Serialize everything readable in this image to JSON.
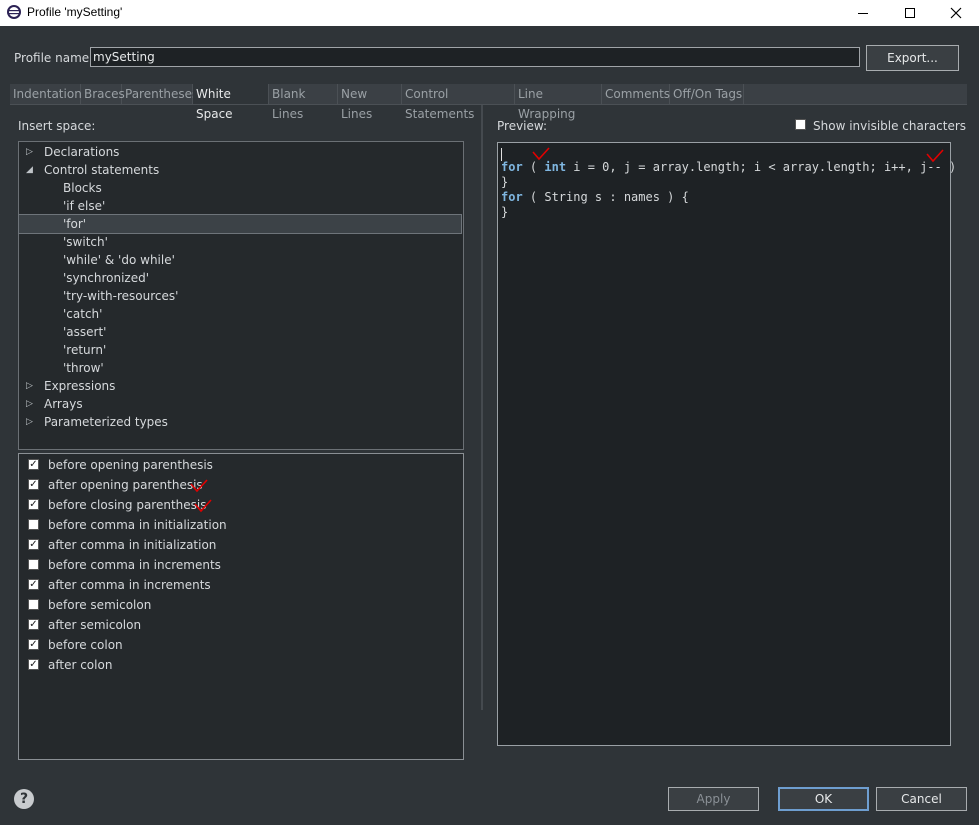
{
  "window": {
    "title": "Profile 'mySetting'"
  },
  "profile": {
    "label": "Profile name:",
    "value": "mySetting",
    "export_label": "Export..."
  },
  "tabs": [
    {
      "label": "Indentation"
    },
    {
      "label": "Braces"
    },
    {
      "label": "Parentheses"
    },
    {
      "label": "White Space",
      "active": true
    },
    {
      "label": "Blank Lines"
    },
    {
      "label": "New Lines"
    },
    {
      "label": "Control Statements"
    },
    {
      "label": "Line Wrapping"
    },
    {
      "label": "Comments"
    },
    {
      "label": "Off/On Tags"
    }
  ],
  "insert_space_label": "Insert space:",
  "tree": [
    {
      "label": "Declarations",
      "arrow": "collapsed"
    },
    {
      "label": "Control statements",
      "arrow": "expanded"
    },
    {
      "label": "Blocks"
    },
    {
      "label": "'if else'"
    },
    {
      "label": "'for'",
      "selected": true
    },
    {
      "label": "'switch'"
    },
    {
      "label": "'while' & 'do while'"
    },
    {
      "label": "'synchronized'"
    },
    {
      "label": "'try-with-resources'"
    },
    {
      "label": "'catch'"
    },
    {
      "label": "'assert'"
    },
    {
      "label": "'return'"
    },
    {
      "label": "'throw'"
    },
    {
      "label": "Expressions",
      "arrow": "collapsed"
    },
    {
      "label": "Arrays",
      "arrow": "collapsed"
    },
    {
      "label": "Parameterized types",
      "arrow": "collapsed"
    }
  ],
  "options": [
    {
      "label": "before opening parenthesis",
      "checked": true
    },
    {
      "label": "after opening parenthesis",
      "checked": true
    },
    {
      "label": "before closing parenthesis",
      "checked": true
    },
    {
      "label": "before comma in initialization",
      "checked": false
    },
    {
      "label": "after comma in initialization",
      "checked": true
    },
    {
      "label": "before comma in increments",
      "checked": false
    },
    {
      "label": "after comma in increments",
      "checked": true
    },
    {
      "label": "before semicolon",
      "checked": false
    },
    {
      "label": "after semicolon",
      "checked": true
    },
    {
      "label": "before colon",
      "checked": true
    },
    {
      "label": "after colon",
      "checked": true
    }
  ],
  "preview": {
    "label": "Preview:",
    "show_invisible_label": "Show invisible characters",
    "show_invisible_checked": false,
    "lines": [
      {
        "kw": "for",
        "rest": " ( ",
        "kw2": "int",
        "tail": " i = 0, j = array.length; i < array.length; i++, j-- )"
      },
      {
        "kw": "",
        "rest": "}",
        "kw2": "",
        "tail": ""
      },
      {
        "kw": "for",
        "rest": " ( String s : names ) {",
        "kw2": "",
        "tail": ""
      },
      {
        "kw": "",
        "rest": "}",
        "kw2": "",
        "tail": ""
      }
    ]
  },
  "buttons": {
    "apply": "Apply",
    "ok": "OK",
    "cancel": "Cancel"
  },
  "colors": {
    "accent": "#6e9ed0",
    "keyword": "#7fb6e0",
    "annotation": "#e00000"
  }
}
